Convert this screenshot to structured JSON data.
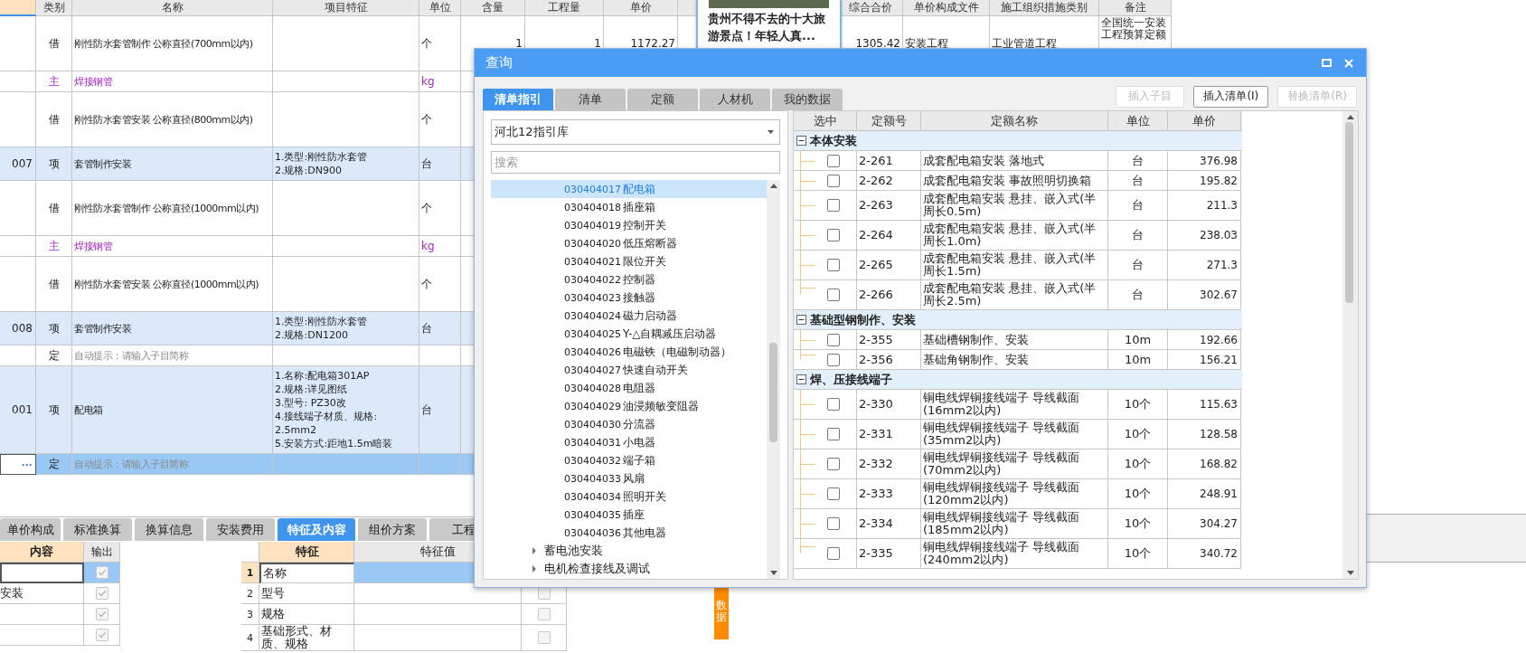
{
  "main_table": {
    "headers": [
      "类别",
      "名称",
      "项目特征",
      "单位",
      "含量",
      "工程量",
      "单价",
      "综合合价",
      "单价构成文件",
      "施工组织措施类别",
      "备注"
    ],
    "rows": [
      {
        "kind": "borrowed",
        "category": "借",
        "name": "刚性防水套管制作 公称直径(700mm以内)",
        "unit": "个",
        "content": "1",
        "quantity": "1",
        "unit_price": "1172.27",
        "total_price": "1305.42",
        "cost_file": "安装工程",
        "measure_type": "工业管道工程",
        "remarks": "全国统一安装工程预算定额",
        "selected": false
      },
      {
        "kind": "material",
        "category": "主",
        "name": "焊接钢管",
        "unit": "kg",
        "selected": false
      },
      {
        "kind": "borrowed",
        "category": "借",
        "name": "刚性防水套管安装 公称直径(800mm以内)",
        "unit": "个",
        "selected": false
      },
      {
        "kind": "item",
        "code": "007",
        "category": "项",
        "name": "套管制作安装",
        "features": [
          "1.类型:刚性防水套管",
          "2.规格:DN900"
        ],
        "unit": "台",
        "selected": false
      },
      {
        "kind": "borrowed",
        "category": "借",
        "name": "刚性防水套管制作 公称直径(1000mm以内)",
        "unit": "个",
        "selected": false
      },
      {
        "kind": "material",
        "category": "主",
        "name": "焊接钢管",
        "unit": "kg",
        "selected": false
      },
      {
        "kind": "borrowed",
        "category": "借",
        "name": "刚性防水套管安装 公称直径(1000mm以内)",
        "unit": "个",
        "selected": false
      },
      {
        "kind": "item",
        "code": "008",
        "category": "项",
        "name": "套管制作安装",
        "features": [
          "1.类型:刚性防水套管",
          "2.规格:DN1200"
        ],
        "unit": "台",
        "selected": false
      },
      {
        "kind": "hint",
        "category": "定",
        "name": "自动提示：请输入子目简称",
        "selected": false
      },
      {
        "kind": "item",
        "code": "001",
        "category": "项",
        "name": "配电箱",
        "features": [
          "1.名称:配电箱301AP",
          "2.规格:详见图纸",
          "3.型号: PZ30改",
          "4.接线端子材质、规格:",
          "2.5mm2",
          "5.安装方式:距地1.5m暗装"
        ],
        "unit": "台",
        "selected": false
      },
      {
        "kind": "hint",
        "more_button": "···",
        "category": "定",
        "name": "自动提示：请输入子目简称",
        "selected": true
      }
    ]
  },
  "ad_popup": {
    "title": "贵州不得不去的十大旅游景点！年轻人真..."
  },
  "bottom_tabs": [
    {
      "label": "单价构成",
      "selected": false
    },
    {
      "label": "标准换算",
      "selected": false
    },
    {
      "label": "换算信息",
      "selected": false
    },
    {
      "label": "安装费用",
      "selected": false
    },
    {
      "label": "特征及内容",
      "selected": true
    },
    {
      "label": "组价方案",
      "selected": false
    },
    {
      "label": "工程",
      "selected": false
    }
  ],
  "work_content": {
    "headers": [
      "内容",
      "输出"
    ],
    "rows": [
      {
        "selected": true,
        "checked": true
      },
      {
        "text": "安装",
        "selected": false,
        "checked": true
      },
      {
        "selected": false,
        "checked": true
      },
      {
        "selected": false,
        "checked": true
      }
    ]
  },
  "features_grid": {
    "headers": [
      "特征",
      "特征值"
    ],
    "rows": [
      {
        "index": "1",
        "feature": "名称",
        "selected": true
      },
      {
        "index": "2",
        "feature": "型号",
        "selected": false,
        "checked": false
      },
      {
        "index": "3",
        "feature": "规格",
        "selected": false,
        "checked": false
      },
      {
        "index": "4",
        "feature": "基础形式、材质、规格",
        "selected": false,
        "checked": false
      }
    ]
  },
  "side_tab": "数据",
  "dialog": {
    "title": "查询",
    "tabs": [
      {
        "label": "清单指引",
        "selected": true
      },
      {
        "label": "清单",
        "selected": false
      },
      {
        "label": "定额",
        "selected": false
      },
      {
        "label": "人材机",
        "selected": false
      },
      {
        "label": "我的数据",
        "selected": false
      }
    ],
    "buttons": [
      {
        "label": "插入子目",
        "disabled": true
      },
      {
        "label": "插入清单(I)",
        "disabled": false
      },
      {
        "label": "替换清单(R)",
        "disabled": true
      }
    ],
    "library": "河北12指引库",
    "search": {
      "placeholder": "搜索"
    },
    "tree_items": [
      {
        "code": "030404017",
        "name": "配电箱",
        "selected": true
      },
      {
        "code": "030404018",
        "name": "插座箱",
        "selected": false
      },
      {
        "code": "030404019",
        "name": "控制开关",
        "selected": false
      },
      {
        "code": "030404020",
        "name": "低压熔断器",
        "selected": false
      },
      {
        "code": "030404021",
        "name": "限位开关",
        "selected": false
      },
      {
        "code": "030404022",
        "name": "控制器",
        "selected": false
      },
      {
        "code": "030404023",
        "name": "接触器",
        "selected": false
      },
      {
        "code": "030404024",
        "name": "磁力启动器",
        "selected": false
      },
      {
        "code": "030404025",
        "name": "Y-△自耦减压启动器",
        "selected": false
      },
      {
        "code": "030404026",
        "name": "电磁铁（电磁制动器）",
        "selected": false
      },
      {
        "code": "030404027",
        "name": "快速自动开关",
        "selected": false
      },
      {
        "code": "030404028",
        "name": "电阻器",
        "selected": false
      },
      {
        "code": "030404029",
        "name": "油浸频敏变阻器",
        "selected": false
      },
      {
        "code": "030404030",
        "name": "分流器",
        "selected": false
      },
      {
        "code": "030404031",
        "name": "小电器",
        "selected": false
      },
      {
        "code": "030404032",
        "name": "端子箱",
        "selected": false
      },
      {
        "code": "030404033",
        "name": "风扇",
        "selected": false
      },
      {
        "code": "030404034",
        "name": "照明开关",
        "selected": false
      },
      {
        "code": "030404035",
        "name": "插座",
        "selected": false
      },
      {
        "code": "030404036",
        "name": "其他电器",
        "selected": false
      }
    ],
    "tree_groups": [
      {
        "label": "蓄电池安装",
        "expanded": false
      },
      {
        "label": "电机检查接线及调试",
        "expanded": false
      }
    ],
    "quota_headers": [
      "选中",
      "定额号",
      "定额名称",
      "单位",
      "单价"
    ],
    "quota_groups": [
      {
        "label": "本体安装",
        "expanded": true,
        "rows": [
          {
            "code": "2-261",
            "name": "成套配电箱安装 落地式",
            "unit": "台",
            "price": "376.98",
            "checked": false
          },
          {
            "code": "2-262",
            "name": "成套配电箱安装 事故照明切换箱",
            "unit": "台",
            "price": "195.82",
            "checked": false
          },
          {
            "code": "2-263",
            "name": "成套配电箱安装 悬挂、嵌入式(半周长0.5m)",
            "unit": "台",
            "price": "211.3",
            "checked": false
          },
          {
            "code": "2-264",
            "name": "成套配电箱安装 悬挂、嵌入式(半周长1.0m)",
            "unit": "台",
            "price": "238.03",
            "checked": false
          },
          {
            "code": "2-265",
            "name": "成套配电箱安装 悬挂、嵌入式(半周长1.5m)",
            "unit": "台",
            "price": "271.3",
            "checked": false
          },
          {
            "code": "2-266",
            "name": "成套配电箱安装 悬挂、嵌入式(半周长2.5m)",
            "unit": "台",
            "price": "302.67",
            "checked": false
          }
        ]
      },
      {
        "label": "基础型钢制作、安装",
        "expanded": true,
        "rows": [
          {
            "code": "2-355",
            "name": "基础槽钢制作、安装",
            "unit": "10m",
            "price": "192.66",
            "checked": false
          },
          {
            "code": "2-356",
            "name": "基础角钢制作、安装",
            "unit": "10m",
            "price": "156.21",
            "checked": false
          }
        ]
      },
      {
        "label": "焊、压接线端子",
        "expanded": true,
        "rows": [
          {
            "code": "2-330",
            "name": "铜电线焊铜接线端子 导线截面(16mm2以内)",
            "unit": "10个",
            "price": "115.63",
            "checked": false
          },
          {
            "code": "2-331",
            "name": "铜电线焊铜接线端子 导线截面(35mm2以内)",
            "unit": "10个",
            "price": "128.58",
            "checked": false
          },
          {
            "code": "2-332",
            "name": "铜电线焊铜接线端子 导线截面(70mm2以内)",
            "unit": "10个",
            "price": "168.82",
            "checked": false
          },
          {
            "code": "2-333",
            "name": "铜电线焊铜接线端子 导线截面(120mm2以内)",
            "unit": "10个",
            "price": "248.91",
            "checked": false
          },
          {
            "code": "2-334",
            "name": "铜电线焊铜接线端子 导线截面(185mm2以内)",
            "unit": "10个",
            "price": "304.27",
            "checked": false
          },
          {
            "code": "2-335",
            "name": "铜电线焊铜接线端子 导线截面(240mm2以内)",
            "unit": "10个",
            "price": "340.72",
            "checked": false
          }
        ]
      }
    ]
  }
}
